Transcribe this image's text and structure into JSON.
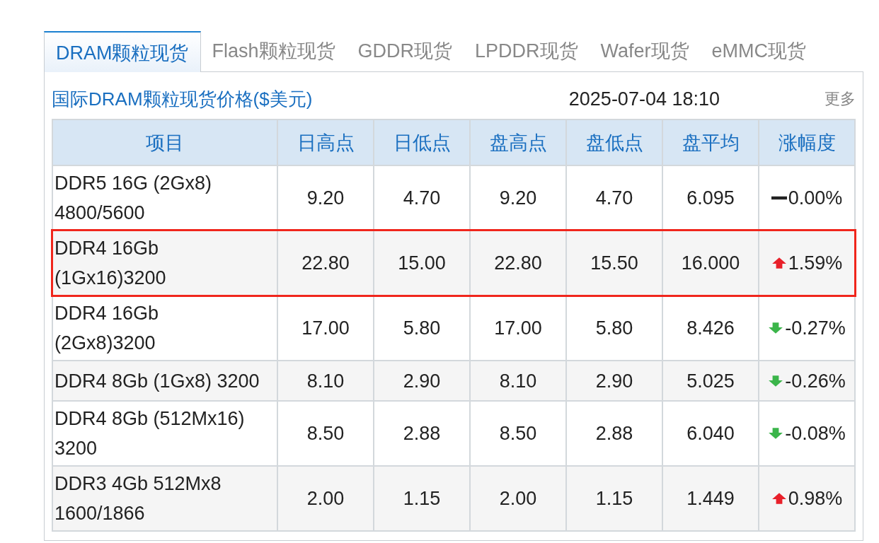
{
  "tabs": [
    {
      "label": "DRAM颗粒现货",
      "selected": true
    },
    {
      "label": "Flash颗粒现货",
      "selected": false
    },
    {
      "label": "GDDR现货",
      "selected": false
    },
    {
      "label": "LPDDR现货",
      "selected": false
    },
    {
      "label": "Wafer现货",
      "selected": false
    },
    {
      "label": "eMMC现货",
      "selected": false
    }
  ],
  "panel": {
    "title": "国际DRAM颗粒现货价格($美元)",
    "timestamp": "2025-07-04 18:10",
    "more_link": "更多"
  },
  "table": {
    "columns": [
      "项目",
      "日高点",
      "日低点",
      "盘高点",
      "盘低点",
      "盘平均",
      "涨幅度"
    ],
    "rows": [
      {
        "cells": [
          "DDR5 16G (2Gx8)\n4800/5600",
          "9.20",
          "4.70",
          "9.20",
          "4.70",
          "6.095",
          "0.00%"
        ],
        "kind": "flat",
        "highlighted": false
      },
      {
        "cells": [
          "DDR4 16Gb\n(1Gx16)3200",
          "22.80",
          "15.00",
          "22.80",
          "15.50",
          "16.000",
          "1.59%"
        ],
        "kind": "up",
        "highlighted": true
      },
      {
        "cells": [
          "DDR4 16Gb\n(2Gx8)3200",
          "17.00",
          "5.80",
          "17.00",
          "5.80",
          "8.426",
          "-0.27%"
        ],
        "kind": "down",
        "highlighted": false
      },
      {
        "cells": [
          "DDR4 8Gb (1Gx8) 3200",
          "8.10",
          "2.90",
          "8.10",
          "2.90",
          "5.025",
          "-0.26%"
        ],
        "kind": "down",
        "highlighted": false
      },
      {
        "cells": [
          "DDR4 8Gb (512Mx16)\n3200",
          "8.50",
          "2.88",
          "8.50",
          "2.88",
          "6.040",
          "-0.08%"
        ],
        "kind": "down",
        "highlighted": false
      },
      {
        "cells": [
          "DDR3 4Gb 512Mx8\n1600/1866",
          "2.00",
          "1.15",
          "2.00",
          "1.15",
          "1.449",
          "0.98%"
        ],
        "kind": "up",
        "highlighted": false
      }
    ]
  }
}
